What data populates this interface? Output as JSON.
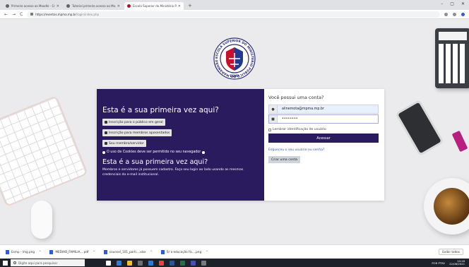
{
  "browser": {
    "tabs": [
      {
        "label": "Primeiro acesso ao Moodle - Cri...",
        "active": false
      },
      {
        "label": "Tutorial primeiro acesso ao Mo...",
        "active": false
      },
      {
        "label": "Escola Superior do Ministério P...",
        "active": true
      }
    ],
    "window_controls": [
      "–",
      "▢",
      "✕"
    ],
    "nav": {
      "back": "←",
      "forward": "→",
      "reload": "C"
    },
    "url": {
      "host": "https://eventos.mpma.mp.br",
      "path": "/login/index.php"
    }
  },
  "logo": {
    "ring_text": "ESCOLA SUPERIOR DO MINISTÉRIO PÚBLICO DO MARANHÃO",
    "bottom_text": "ESMP",
    "colors": {
      "ring": "#2a2a7a",
      "red": "#c8102e",
      "blue": "#1f3b8f"
    }
  },
  "login": {
    "left": {
      "title": "Esta é a sua primeira vez aqui?",
      "btn_public": "Inscrição para o público em geral",
      "btn_retired": "Inscrição para membros aposentados",
      "btn_member": "Sou membro/servidor",
      "cookies_notice": "O uso de Cookies deve ser permitido no seu navegador",
      "title2": "Esta é a sua primeira vez aqui?",
      "info": "Membros e servidores já possuem cadastro. Faça seu login ao lado usando as mesmas credenciais do e-mail institucional."
    },
    "right": {
      "title": "Você possui uma conta?",
      "username_value": "alinemota@mpma.mp.br",
      "password_value": "••••••••",
      "remember_label": "Lembrar identificação de usuário",
      "login_button": "Acessar",
      "forgot_link": "Esqueceu o seu usuário ou senha?",
      "create_account": "Criar uma conta"
    },
    "colors": {
      "primary": "#2a1a5e",
      "link": "#2f5ab5"
    }
  },
  "downloads": {
    "items": [
      "Esmp - Img.png",
      "MEDIAO_FAMILIA....pdf",
      "counsel_101_parti....xlsx",
      "Sr a educação fís....png"
    ],
    "show_all": "Exibir todos"
  },
  "taskbar": {
    "search_placeholder": "Digite aqui para pesquisar",
    "lang": "POR PTB2",
    "time": "10:18",
    "date": "22/06/2021"
  }
}
